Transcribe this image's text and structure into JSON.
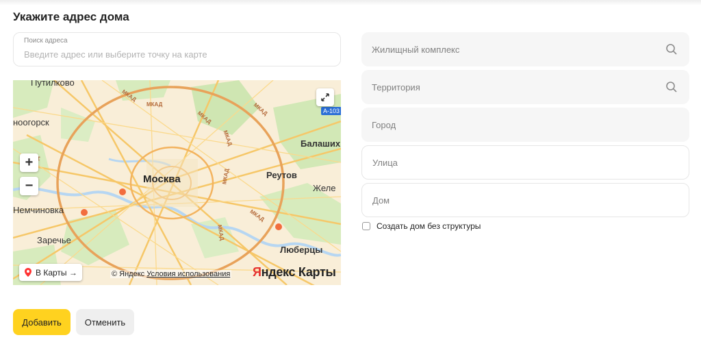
{
  "page": {
    "title": "Укажите адрес дома"
  },
  "address": {
    "label": "Поиск адреса",
    "placeholder": "Введите адрес или выберите точку на карте"
  },
  "map": {
    "labels": {
      "moscow": "Москва",
      "putilkovo": "Путилково",
      "dolgoprudny": "ноогорск",
      "balashikha": "Балаших",
      "reutov": "Реутов",
      "zhel": "Желе",
      "nemchinovka": "Немчиновка",
      "zarechye": "Заречье",
      "lyubertsy": "Люберцы",
      "mkad": "МКАД",
      "road_a103": "А-103",
      "zoom_in": "+",
      "zoom_out": "−"
    },
    "to_maps": "В Карты →",
    "copyright_prefix": "© Яндекс",
    "terms": "Условия использования",
    "logo_y": "Я",
    "logo_rest": "ндекс Карты"
  },
  "fields": {
    "complex": "Жилищный комплекс",
    "territory": "Территория",
    "city": "Город",
    "street": "Улица",
    "house": "Дом"
  },
  "checkbox": {
    "label": "Создать дом без структуры",
    "checked": false
  },
  "actions": {
    "add": "Добавить",
    "cancel": "Отменить"
  },
  "colors": {
    "primary": "#ffd21f",
    "secondary": "#efefef",
    "field_bg": "#f6f6f6",
    "border": "#e6e6e6"
  },
  "icons": [
    "search-icon",
    "expand-icon",
    "location-pin-icon"
  ]
}
